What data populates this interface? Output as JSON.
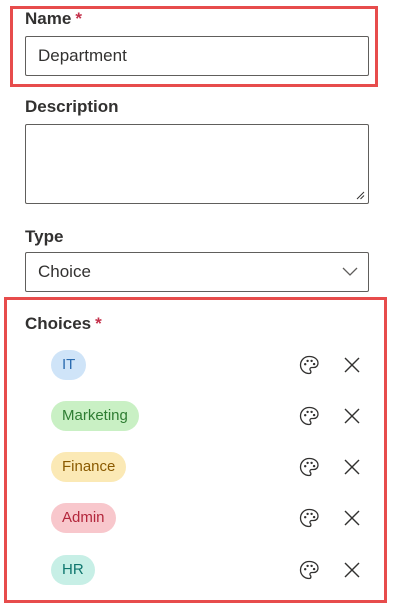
{
  "name": {
    "label": "Name",
    "required_mark": "*",
    "value": "Department"
  },
  "description": {
    "label": "Description",
    "value": ""
  },
  "type": {
    "label": "Type",
    "value": "Choice"
  },
  "choices": {
    "label": "Choices",
    "required_mark": "*",
    "items": [
      {
        "label": "IT",
        "bg": "#cfe4f8",
        "fg": "#2b6cb0"
      },
      {
        "label": "Marketing",
        "bg": "#c9f0c4",
        "fg": "#2e7d32"
      },
      {
        "label": "Finance",
        "bg": "#fbe9b5",
        "fg": "#8a5a00"
      },
      {
        "label": "Admin",
        "bg": "#f8c7cc",
        "fg": "#b3263b"
      },
      {
        "label": "HR",
        "bg": "#c7efe6",
        "fg": "#0f766e"
      }
    ]
  },
  "colors": {
    "highlight": "#e74c4c",
    "required": "#c4314b",
    "border": "#605e5c"
  },
  "icons": {
    "palette": "palette-icon",
    "remove": "close-icon",
    "dropdown": "chevron-down-icon",
    "resize": "resize-grip-icon"
  }
}
